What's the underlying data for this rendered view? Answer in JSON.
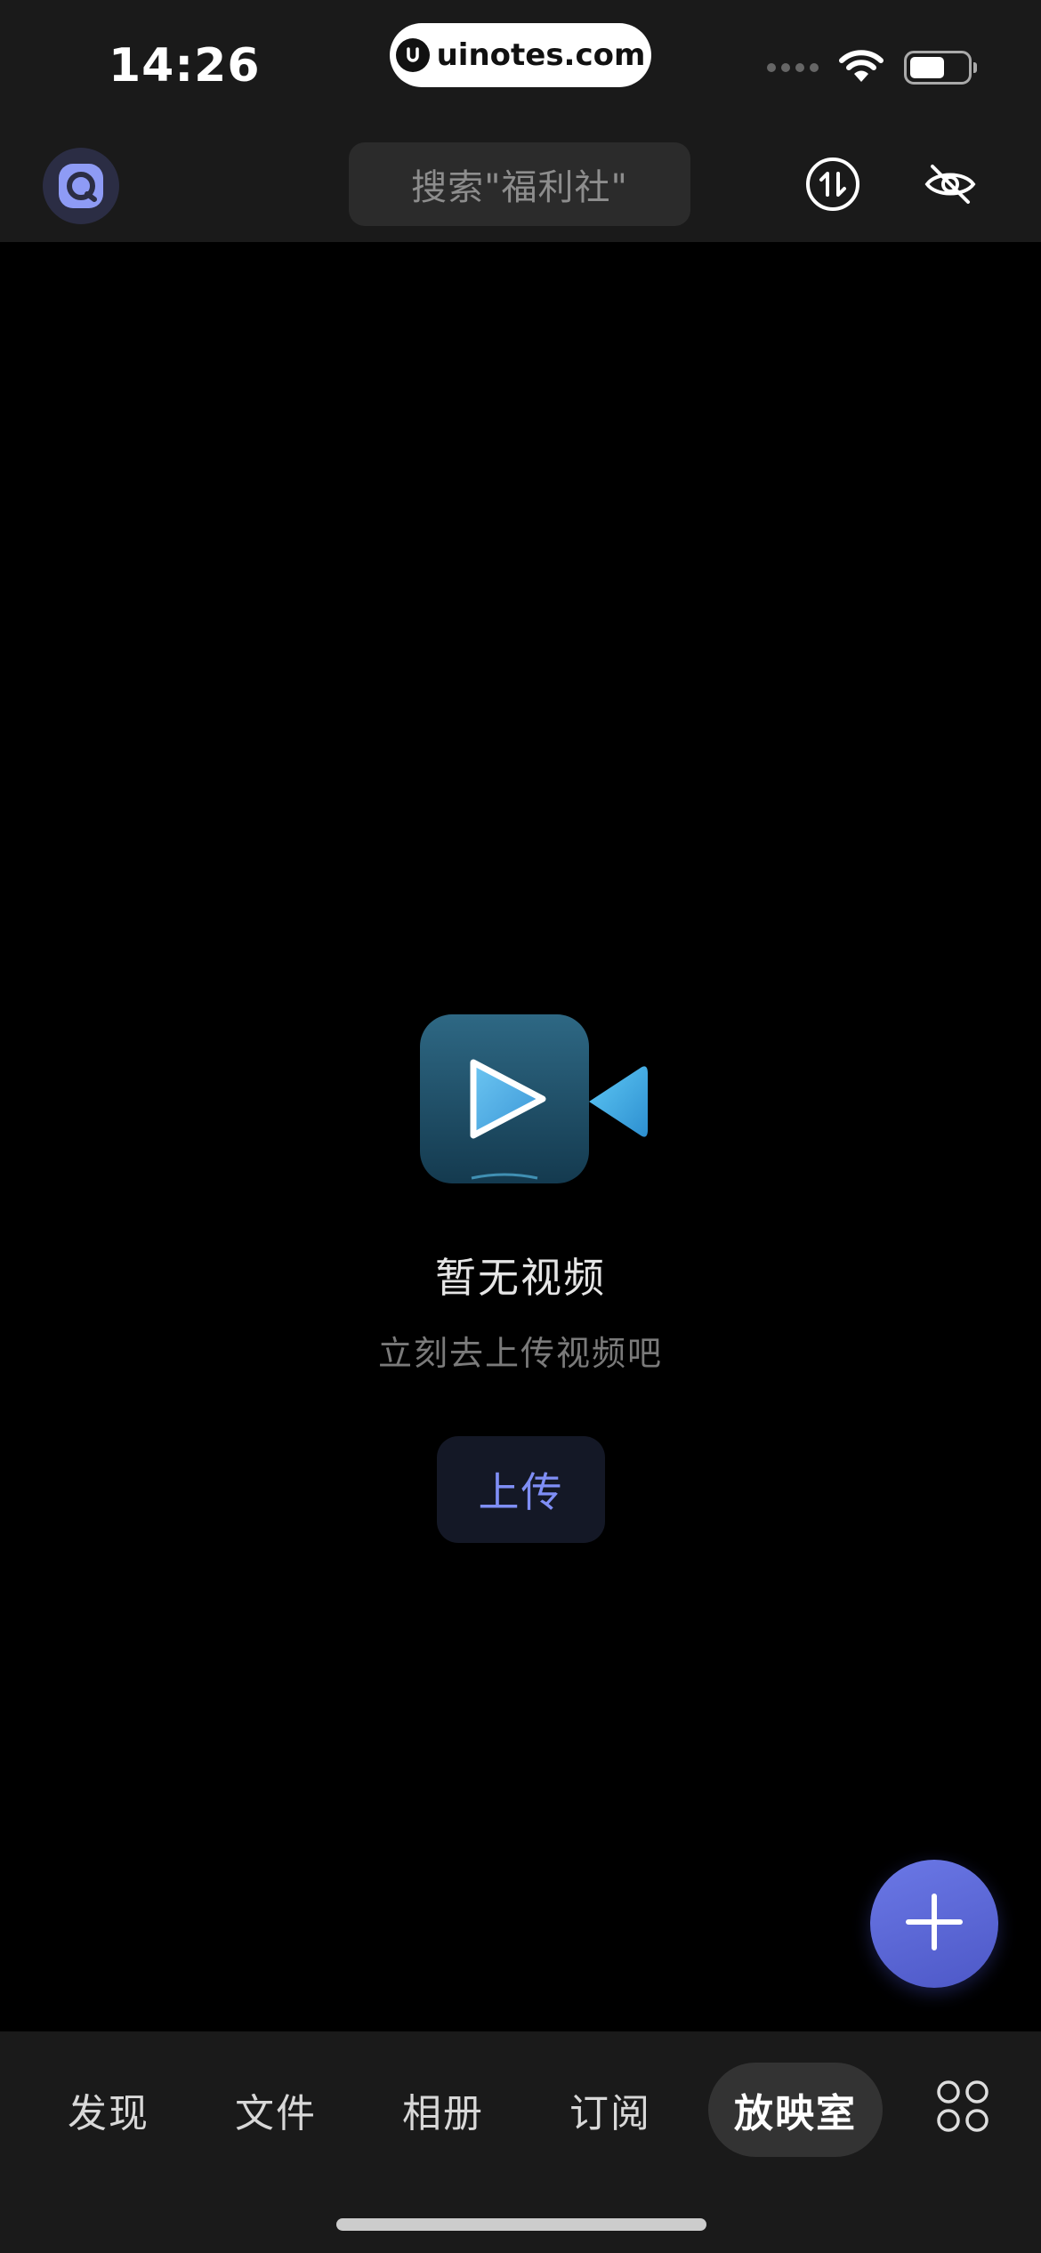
{
  "status_bar": {
    "time": "14:26",
    "watermark": "uinotes.com"
  },
  "header": {
    "search_placeholder": "搜索\"福利社\"",
    "icons": [
      "app-avatar-icon",
      "transfer-icon",
      "eye-off-icon"
    ]
  },
  "empty_state": {
    "title": "暂无视频",
    "subtitle": "立刻去上传视频吧",
    "upload_label": "上传"
  },
  "fab": {
    "icon": "plus-icon"
  },
  "tabs": [
    {
      "label": "发现",
      "active": false
    },
    {
      "label": "文件",
      "active": false
    },
    {
      "label": "相册",
      "active": false
    },
    {
      "label": "订阅",
      "active": false
    },
    {
      "label": "放映室",
      "active": true
    }
  ],
  "colors": {
    "accent": "#6b78e6",
    "upload_text": "#7f8ef5",
    "background": "#000000",
    "bar_background": "#1a1a1a"
  }
}
